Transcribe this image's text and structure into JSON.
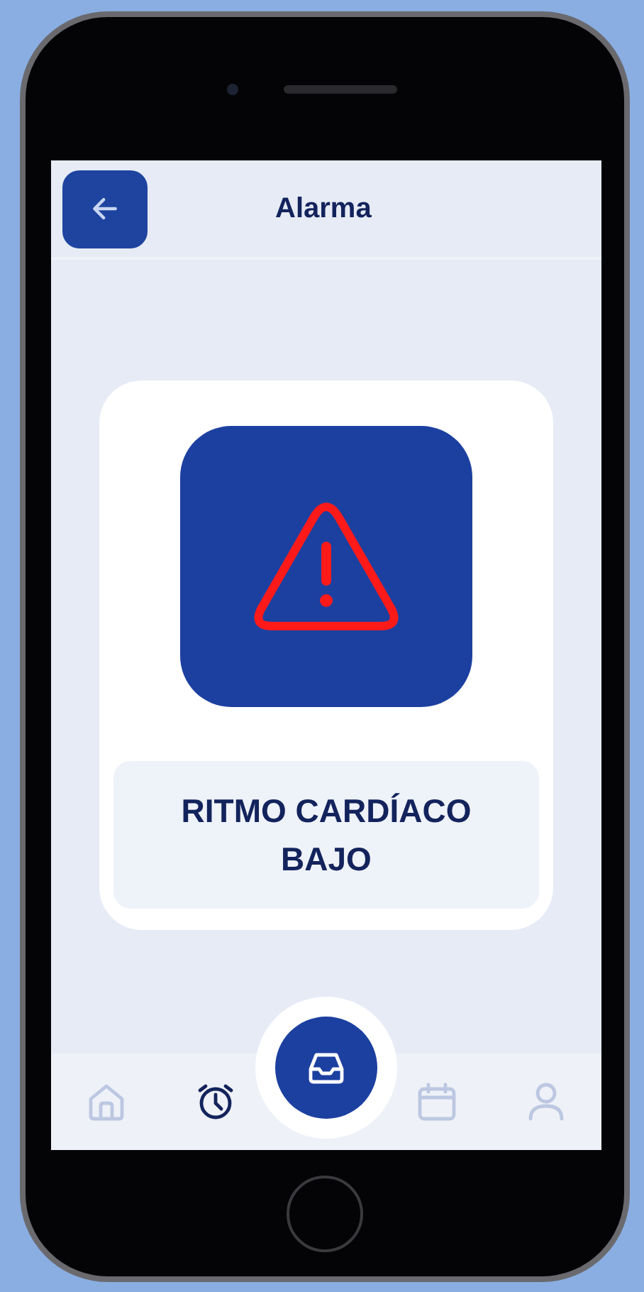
{
  "header": {
    "title": "Alarma"
  },
  "alert": {
    "message": "RITMO CARDÍACO BAJO"
  },
  "nav": [
    {
      "kind": "home",
      "selected": false
    },
    {
      "kind": "alarm",
      "selected": true
    },
    {
      "kind": "inbox",
      "selected": false
    },
    {
      "kind": "calendar",
      "selected": false
    },
    {
      "kind": "profile",
      "selected": false
    }
  ]
}
